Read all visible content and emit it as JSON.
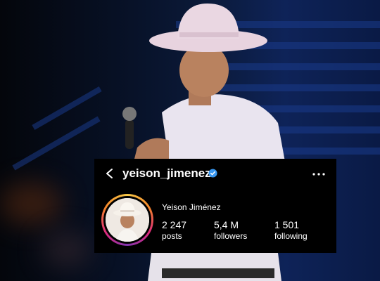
{
  "profile": {
    "username": "yeison_jimenez",
    "full_name": "Yeison Jiménez",
    "verified_icon": "verified-badge-icon",
    "back_icon": "chevron-left-icon",
    "more_icon": "more-horizontal-icon"
  },
  "stats": [
    {
      "value": "2 247",
      "label": "posts"
    },
    {
      "value": "5,4 M",
      "label": "followers"
    },
    {
      "value": "1 501",
      "label": "following"
    }
  ],
  "colors": {
    "panel_bg": "#000000",
    "verified": "#3897f0",
    "ring": [
      "#f7c948",
      "#f58529",
      "#dd2a7b",
      "#8134af"
    ]
  }
}
